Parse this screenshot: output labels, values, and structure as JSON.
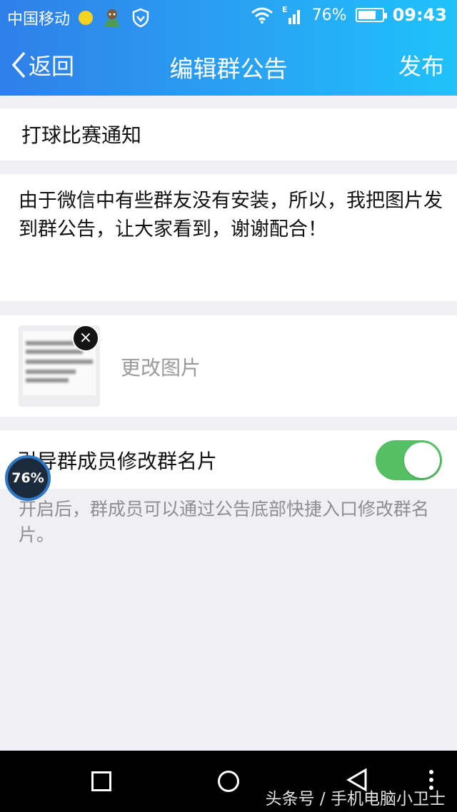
{
  "status_bar": {
    "carrier": "中国移动",
    "network": "E",
    "battery_text": "76%",
    "battery_level": 0.76,
    "time": "09:43"
  },
  "nav": {
    "back_label": "返回",
    "title": "编辑群公告",
    "publish_label": "发布"
  },
  "announcement": {
    "title": "打球比赛通知",
    "body": "由于微信中有些群友没有安装，所以，我把图片发到群公告，让大家看到，谢谢配合！"
  },
  "image_section": {
    "remove_icon": "×",
    "change_label": "更改图片"
  },
  "toggle_section": {
    "label": "引导群成员修改群名片",
    "enabled": true,
    "hint": "开启后，群成员可以通过公告底部快捷入口修改群名片。"
  },
  "floating_widget": {
    "value": "76%"
  },
  "system_nav": {
    "watermark": "头条号 / 手机电脑小卫士"
  },
  "colors": {
    "header_start": "#2f7fe8",
    "header_end": "#1fc2fb",
    "toggle_on": "#55c063",
    "background": "#efeff4"
  }
}
